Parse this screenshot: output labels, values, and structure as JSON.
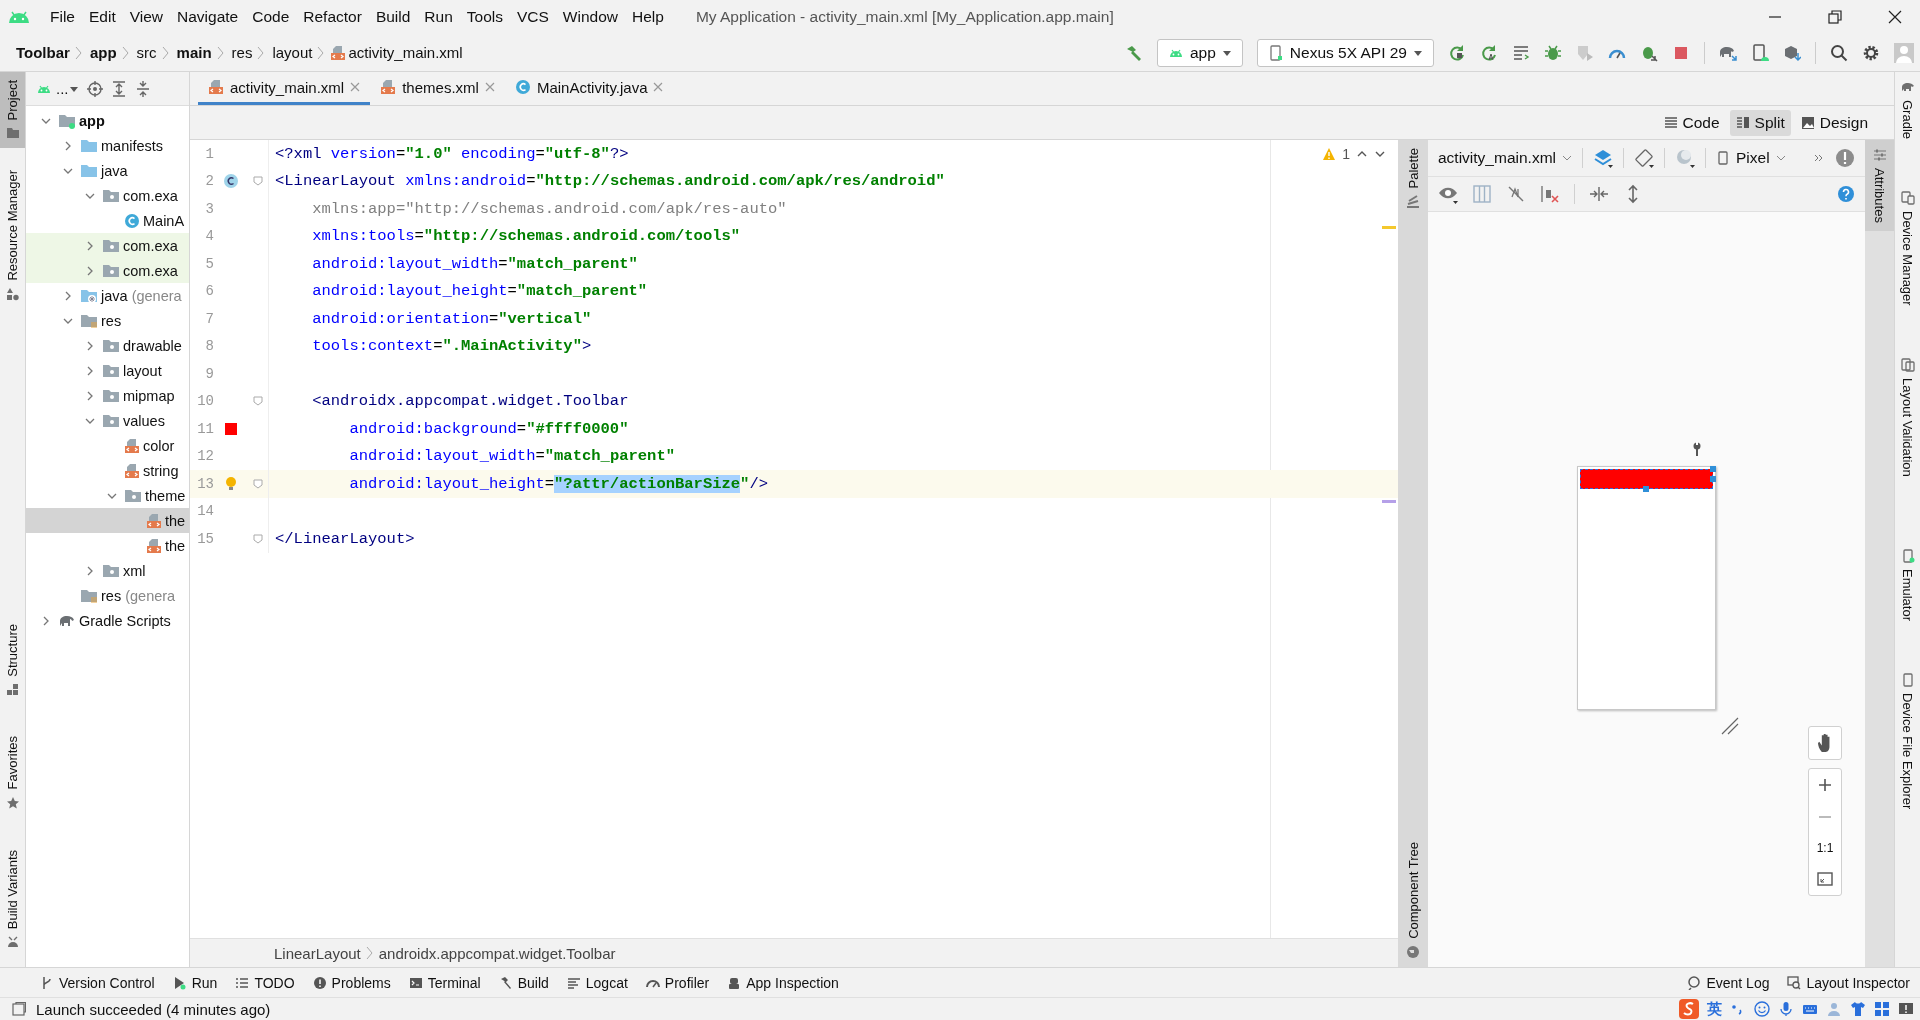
{
  "window": {
    "title": "My Application - activity_main.xml [My_Application.app.main]"
  },
  "menu": [
    "File",
    "Edit",
    "View",
    "Navigate",
    "Code",
    "Refactor",
    "Build",
    "Run",
    "Tools",
    "VCS",
    "Window",
    "Help"
  ],
  "breadcrumbs": [
    {
      "label": "Toolbar",
      "bold": true
    },
    {
      "label": "app",
      "bold": true
    },
    {
      "label": "src",
      "bold": false
    },
    {
      "label": "main",
      "bold": true
    },
    {
      "label": "res",
      "bold": false
    },
    {
      "label": "layout",
      "bold": false
    },
    {
      "label": "activity_main.xml",
      "bold": false,
      "kind": "xml"
    }
  ],
  "run_configuration": {
    "label": "app"
  },
  "device": {
    "label": "Nexus 5X API 29"
  },
  "left_tool_tabs_top": [
    {
      "label": "Project",
      "selected": true,
      "kind": "folder"
    },
    {
      "label": "Resource Manager",
      "selected": false,
      "kind": "shapes"
    }
  ],
  "left_tool_tabs_bottom": [
    {
      "label": "Structure",
      "selected": false,
      "kind": "structure"
    },
    {
      "label": "Favorites",
      "selected": false,
      "kind": "star"
    },
    {
      "label": "Build Variants",
      "selected": false,
      "kind": "variants"
    }
  ],
  "right_tool_tabs_top": [
    {
      "label": "Gradle",
      "kind": "gradle"
    },
    {
      "label": "Device Manager",
      "kind": "devices"
    },
    {
      "label": "Layout Validation",
      "kind": "validation"
    }
  ],
  "right_tool_tabs_bottom": [
    {
      "label": "Emulator",
      "kind": "emulator"
    },
    {
      "label": "Device File Explorer",
      "kind": "device"
    }
  ],
  "project_panel": {
    "view_label": "...",
    "tree": [
      {
        "label": "app",
        "kind": "module",
        "expanded": true,
        "selected": false,
        "children": [
          {
            "label": "manifests",
            "kind": "folder",
            "expanded": false,
            "selected": false
          },
          {
            "label": "java",
            "kind": "folder",
            "expanded": true,
            "selected": false,
            "children": [
              {
                "label": "com.exa",
                "kind": "package",
                "expanded": true,
                "selected": false,
                "children": [
                  {
                    "label": "MainA",
                    "kind": "class",
                    "selected": false
                  }
                ]
              },
              {
                "label": "com.exa",
                "kind": "test-package",
                "expanded": false,
                "selected": false
              },
              {
                "label": "com.exa",
                "kind": "test-package",
                "expanded": false,
                "selected": false
              }
            ]
          },
          {
            "label": "java",
            "suffix": "(genera",
            "kind": "gen-folder",
            "expanded": false,
            "selected": false
          },
          {
            "label": "res",
            "kind": "res-folder",
            "expanded": true,
            "selected": false,
            "children": [
              {
                "label": "drawable",
                "kind": "package",
                "expanded": false,
                "selected": false
              },
              {
                "label": "layout",
                "kind": "package",
                "expanded": false,
                "selected": false
              },
              {
                "label": "mipmap",
                "kind": "package",
                "expanded": false,
                "selected": false
              },
              {
                "label": "values",
                "kind": "package",
                "expanded": true,
                "selected": false,
                "children": [
                  {
                    "label": "color",
                    "kind": "xml",
                    "selected": false
                  },
                  {
                    "label": "string",
                    "kind": "xml",
                    "selected": false
                  },
                  {
                    "label": "theme",
                    "kind": "package",
                    "expanded": true,
                    "selected": false,
                    "children": [
                      {
                        "label": "the",
                        "kind": "xml",
                        "selected": true
                      },
                      {
                        "label": "the",
                        "kind": "xml",
                        "selected": false
                      }
                    ]
                  }
                ]
              },
              {
                "label": "xml",
                "kind": "package",
                "expanded": false,
                "selected": false
              }
            ]
          },
          {
            "label": "res",
            "suffix": "(genera",
            "kind": "res-folder",
            "selected": false
          }
        ]
      },
      {
        "label": "Gradle Scripts",
        "kind": "gradle",
        "expanded": false,
        "selected": false
      }
    ]
  },
  "editor_tabs": [
    {
      "label": "activity_main.xml",
      "kind": "xml",
      "selected": true
    },
    {
      "label": "themes.xml",
      "kind": "xml",
      "selected": false
    },
    {
      "label": "MainActivity.java",
      "kind": "class",
      "selected": false
    }
  ],
  "view_modes": [
    {
      "label": "Code",
      "kind": "code",
      "selected": false
    },
    {
      "label": "Split",
      "kind": "split",
      "selected": true
    },
    {
      "label": "Design",
      "kind": "design",
      "selected": false
    }
  ],
  "inspections": {
    "warnings": "1"
  },
  "code_lines": [
    {
      "number": "1",
      "current": false,
      "fold": false,
      "kind": "plain",
      "tokens": [
        {
          "kind": "tag",
          "text": "<?xml "
        },
        {
          "kind": "attr",
          "text": "version"
        },
        {
          "kind": "plain",
          "text": "="
        },
        {
          "kind": "value",
          "text": "\"1.0\""
        },
        {
          "kind": "attr",
          "text": " encoding"
        },
        {
          "kind": "plain",
          "text": "="
        },
        {
          "kind": "value",
          "text": "\"utf-8\""
        },
        {
          "kind": "tag",
          "text": "?>"
        }
      ]
    },
    {
      "number": "2",
      "current": false,
      "fold": true,
      "kind": "class",
      "tokens": [
        {
          "kind": "tag",
          "text": "<LinearLayout "
        },
        {
          "kind": "attr",
          "text": "xmlns:android"
        },
        {
          "kind": "plain",
          "text": "="
        },
        {
          "kind": "value",
          "text": "\"http://schemas.android.com/apk/res/android\""
        }
      ]
    },
    {
      "number": "3",
      "current": false,
      "fold": false,
      "kind": "plain",
      "tokens": [
        {
          "kind": "unused",
          "text": "    xmlns:app=\"http://schemas.android.com/apk/res-auto\""
        }
      ]
    },
    {
      "number": "4",
      "current": false,
      "fold": false,
      "kind": "plain",
      "tokens": [
        {
          "kind": "attr",
          "text": "    xmlns:tools"
        },
        {
          "kind": "plain",
          "text": "="
        },
        {
          "kind": "value",
          "text": "\"http://schemas.android.com/tools\""
        }
      ]
    },
    {
      "number": "5",
      "current": false,
      "fold": false,
      "kind": "plain",
      "tokens": [
        {
          "kind": "attr",
          "text": "    android:layout_width"
        },
        {
          "kind": "plain",
          "text": "="
        },
        {
          "kind": "value",
          "text": "\"match_parent\""
        }
      ]
    },
    {
      "number": "6",
      "current": false,
      "fold": false,
      "kind": "plain",
      "tokens": [
        {
          "kind": "attr",
          "text": "    android:layout_height"
        },
        {
          "kind": "plain",
          "text": "="
        },
        {
          "kind": "value",
          "text": "\"match_parent\""
        }
      ]
    },
    {
      "number": "7",
      "current": false,
      "fold": false,
      "kind": "plain",
      "tokens": [
        {
          "kind": "attr",
          "text": "    android:orientation"
        },
        {
          "kind": "plain",
          "text": "="
        },
        {
          "kind": "value",
          "text": "\"vertical\""
        }
      ]
    },
    {
      "number": "8",
      "current": false,
      "fold": false,
      "kind": "plain",
      "tokens": [
        {
          "kind": "attr",
          "text": "    tools:context"
        },
        {
          "kind": "plain",
          "text": "="
        },
        {
          "kind": "value",
          "text": "\".MainActivity\""
        },
        {
          "kind": "tag",
          "text": ">"
        }
      ]
    },
    {
      "number": "9",
      "current": false,
      "fold": false,
      "kind": "plain"
    },
    {
      "number": "10",
      "current": false,
      "fold": true,
      "kind": "plain",
      "tokens": [
        {
          "kind": "tag",
          "text": "    <androidx.appcompat.widget.Toolbar"
        }
      ]
    },
    {
      "number": "11",
      "current": false,
      "fold": false,
      "kind": "color",
      "tokens": [
        {
          "kind": "attr",
          "text": "        android:background"
        },
        {
          "kind": "plain",
          "text": "="
        },
        {
          "kind": "value",
          "text": "\"#ffff0000\""
        }
      ]
    },
    {
      "number": "12",
      "current": false,
      "fold": false,
      "kind": "plain",
      "tokens": [
        {
          "kind": "attr",
          "text": "        android:layout_width"
        },
        {
          "kind": "plain",
          "text": "="
        },
        {
          "kind": "value",
          "text": "\"match_parent\""
        }
      ]
    },
    {
      "number": "13",
      "current": true,
      "fold": true,
      "kind": "bulb",
      "tokens": [
        {
          "kind": "attr",
          "text": "        android:layout_height"
        },
        {
          "kind": "plain",
          "text": "="
        },
        {
          "kind": "selected",
          "text": "\"?attr/actionBarSize"
        },
        {
          "kind": "value",
          "text": "\""
        },
        {
          "kind": "tag",
          "text": "/>"
        }
      ]
    },
    {
      "number": "14",
      "current": false,
      "fold": false,
      "kind": "plain"
    },
    {
      "number": "15",
      "current": false,
      "fold": true,
      "kind": "plain",
      "tokens": [
        {
          "kind": "tag",
          "text": "</LinearLayout>"
        }
      ]
    }
  ],
  "editor_breadcrumbs": [
    "LinearLayout",
    "androidx.appcompat.widget.Toolbar"
  ],
  "design_panel": {
    "palette_label": "Palette",
    "component_tree_label": "Component Tree",
    "attributes_label": "Attributes",
    "file": "activity_main.xml",
    "device": "Pixel",
    "zoom_actual": "1:1"
  },
  "bottom_tools": [
    {
      "label": "Version Control",
      "kind": "vcs"
    },
    {
      "label": "Run",
      "kind": "run"
    },
    {
      "label": "TODO",
      "kind": "todo"
    },
    {
      "label": "Problems",
      "kind": "problems"
    },
    {
      "label": "Terminal",
      "kind": "terminal"
    },
    {
      "label": "Build",
      "kind": "build"
    },
    {
      "label": "Logcat",
      "kind": "logcat"
    },
    {
      "label": "Profiler",
      "kind": "profiler"
    },
    {
      "label": "App Inspection",
      "kind": "inspection"
    }
  ],
  "bottom_tools_right": [
    {
      "label": "Event Log",
      "kind": "eventlog"
    },
    {
      "label": "Layout Inspector",
      "kind": "inspector"
    }
  ],
  "status_bar": {
    "message": "Launch succeeded (4 minutes ago)",
    "ime_label": "英"
  }
}
